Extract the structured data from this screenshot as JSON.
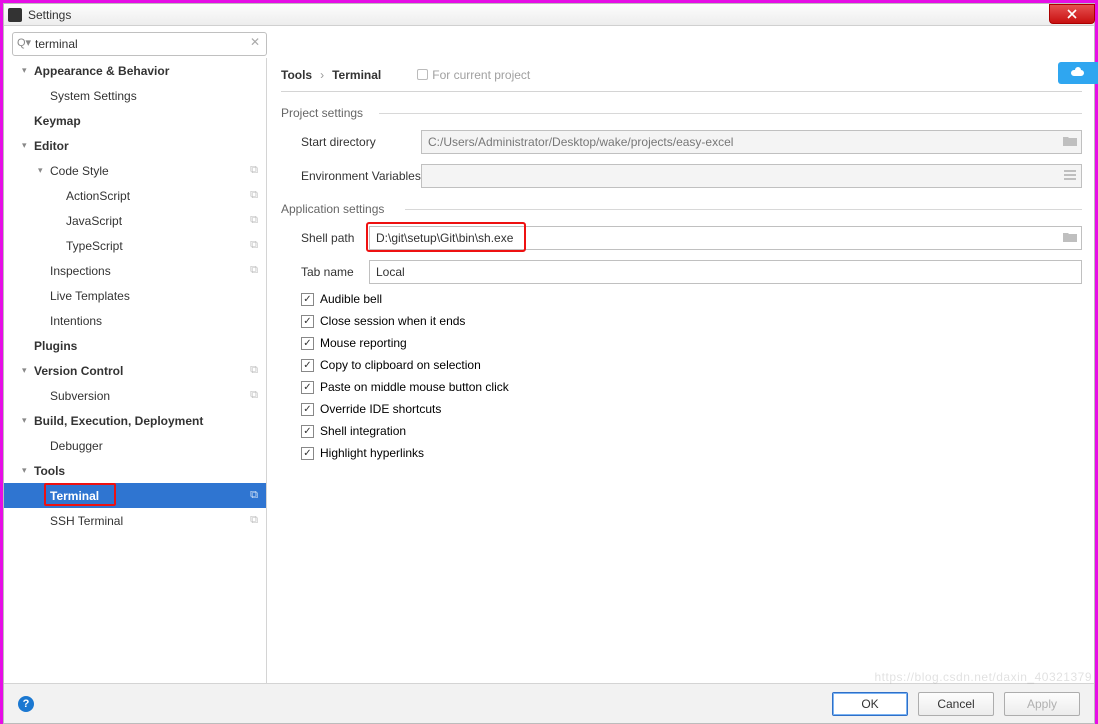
{
  "window_title": "Settings",
  "search_value": "terminal",
  "sidebar": {
    "items": [
      {
        "label": "Appearance & Behavior",
        "level": 1,
        "bold": true,
        "chev": "down"
      },
      {
        "label": "System Settings",
        "level": 2
      },
      {
        "label": "Keymap",
        "level": 1,
        "bold": true
      },
      {
        "label": "Editor",
        "level": 1,
        "bold": true,
        "chev": "down"
      },
      {
        "label": "Code Style",
        "level": 2,
        "chev": "down",
        "copy": true
      },
      {
        "label": "ActionScript",
        "level": 3,
        "copy": true
      },
      {
        "label": "JavaScript",
        "level": 3,
        "copy": true
      },
      {
        "label": "TypeScript",
        "level": 3,
        "copy": true
      },
      {
        "label": "Inspections",
        "level": 2,
        "copy": true
      },
      {
        "label": "Live Templates",
        "level": 2
      },
      {
        "label": "Intentions",
        "level": 2
      },
      {
        "label": "Plugins",
        "level": 1,
        "bold": true
      },
      {
        "label": "Version Control",
        "level": 1,
        "bold": true,
        "chev": "down",
        "copy": true
      },
      {
        "label": "Subversion",
        "level": 2,
        "copy": true
      },
      {
        "label": "Build, Execution, Deployment",
        "level": 1,
        "bold": true,
        "chev": "down"
      },
      {
        "label": "Debugger",
        "level": 2
      },
      {
        "label": "Tools",
        "level": 1,
        "bold": true,
        "chev": "down"
      },
      {
        "label": "Terminal",
        "level": 2,
        "bold": true,
        "selected": true,
        "copy": true,
        "redbox": true
      },
      {
        "label": "SSH Terminal",
        "level": 2,
        "copy": true
      }
    ]
  },
  "breadcrumb": {
    "root": "Tools",
    "leaf": "Terminal",
    "note": "For current project"
  },
  "project_settings_label": "Project settings",
  "application_settings_label": "Application settings",
  "fields": {
    "start_dir_label": "Start directory",
    "start_dir_value": "C:/Users/Administrator/Desktop/wake/projects/easy-excel",
    "env_label": "Environment Variables",
    "env_value": "",
    "shell_path_label": "Shell path",
    "shell_path_value": "D:\\git\\setup\\Git\\bin\\sh.exe",
    "tab_name_label": "Tab name",
    "tab_name_value": "Local"
  },
  "checks": [
    {
      "label": "Audible bell",
      "checked": true
    },
    {
      "label": "Close session when it ends",
      "checked": true
    },
    {
      "label": "Mouse reporting",
      "checked": true
    },
    {
      "label": "Copy to clipboard on selection",
      "checked": true
    },
    {
      "label": "Paste on middle mouse button click",
      "checked": true
    },
    {
      "label": "Override IDE shortcuts",
      "checked": true
    },
    {
      "label": "Shell integration",
      "checked": true
    },
    {
      "label": "Highlight hyperlinks",
      "checked": true
    }
  ],
  "buttons": {
    "ok": "OK",
    "cancel": "Cancel",
    "apply": "Apply"
  },
  "watermark": "https://blog.csdn.net/daxin_40321379"
}
